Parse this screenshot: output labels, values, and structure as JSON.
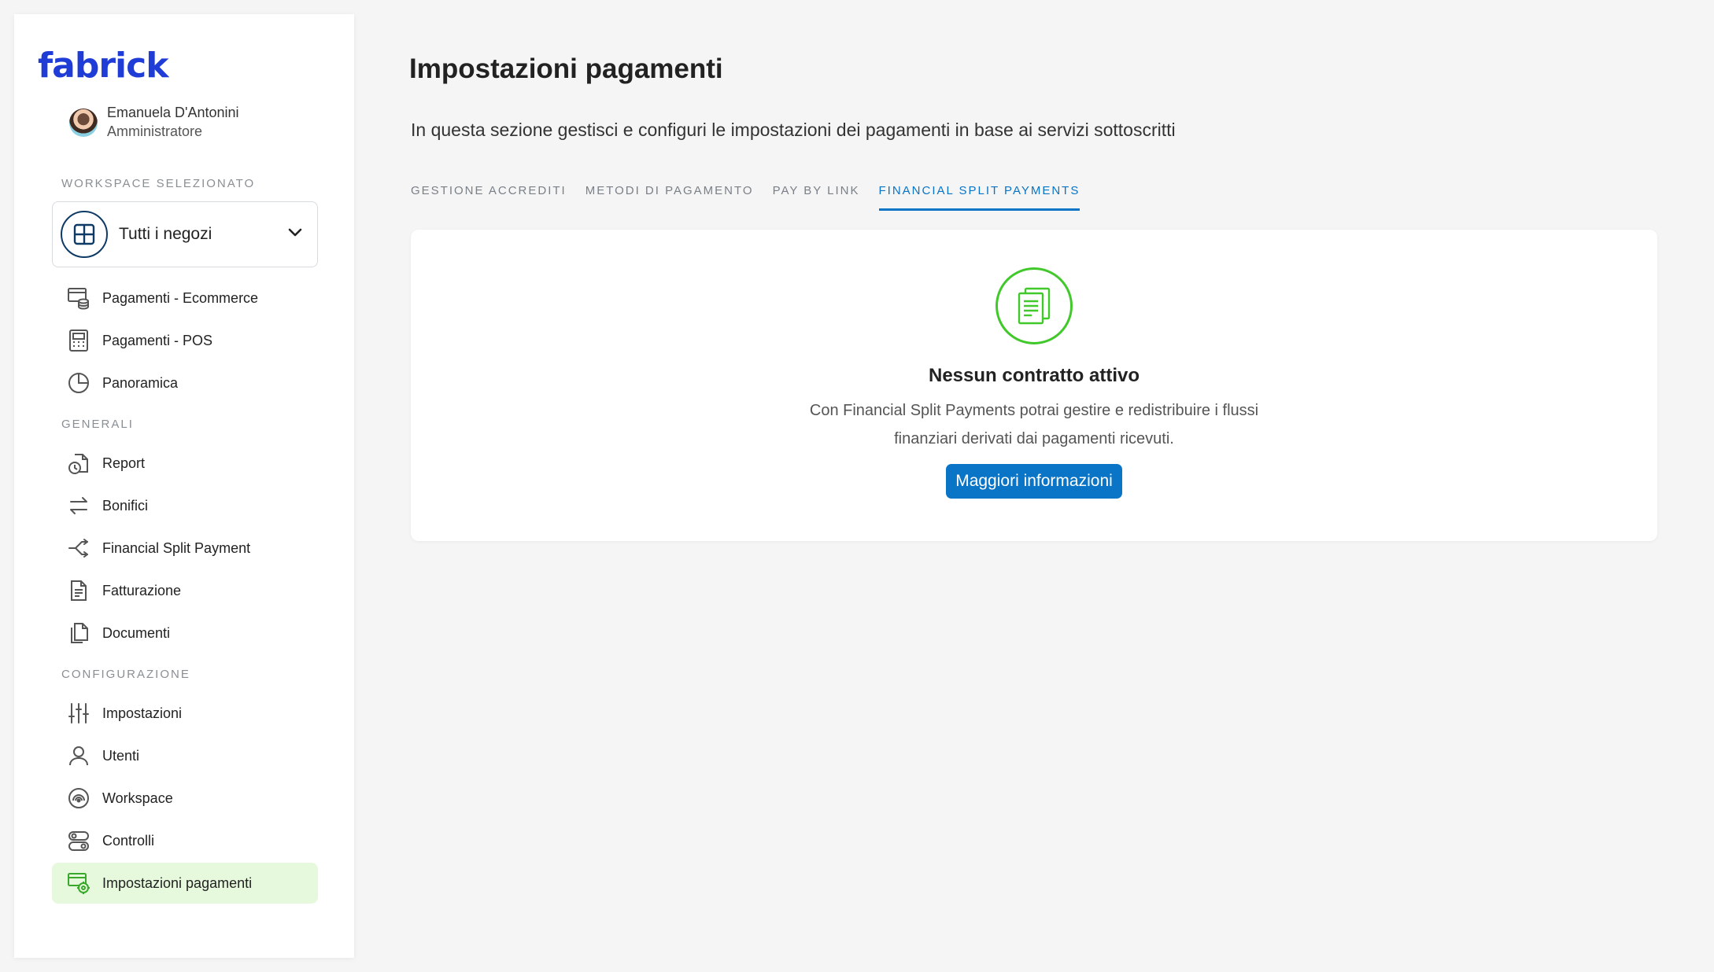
{
  "brand": {
    "logo_text": "fabrick",
    "logo_color": "#1f3dd6"
  },
  "user": {
    "name": "Emanuela D'Antonini",
    "role": "Amministratore"
  },
  "sidebar": {
    "workspace_section_label": "WORKSPACE SELEZIONATO",
    "workspace_select": {
      "value": "Tutti i negozi"
    },
    "top_items": [
      {
        "label": "Pagamenti - Ecommerce",
        "icon": "ecommerce-payments-icon"
      },
      {
        "label": "Pagamenti - POS",
        "icon": "pos-icon"
      },
      {
        "label": "Panoramica",
        "icon": "pie-chart-icon"
      }
    ],
    "generali_label": "GENERALI",
    "generali_items": [
      {
        "label": "Report",
        "icon": "report-icon"
      },
      {
        "label": "Bonifici",
        "icon": "transfer-arrows-icon"
      },
      {
        "label": "Financial Split Payment",
        "icon": "split-icon"
      },
      {
        "label": "Fatturazione",
        "icon": "invoice-icon"
      },
      {
        "label": "Documenti",
        "icon": "documents-icon"
      }
    ],
    "config_label": "CONFIGURAZIONE",
    "config_items": [
      {
        "label": "Impostazioni",
        "icon": "sliders-icon"
      },
      {
        "label": "Utenti",
        "icon": "user-icon"
      },
      {
        "label": "Workspace",
        "icon": "workspace-icon"
      },
      {
        "label": "Controlli",
        "icon": "toggles-icon"
      },
      {
        "label": "Impostazioni pagamenti",
        "icon": "payment-settings-icon",
        "active": true
      }
    ]
  },
  "main": {
    "title": "Impostazioni pagamenti",
    "description": "In questa sezione gestisci e configuri le impostazioni dei pagamenti in base ai servizi sottoscritti",
    "tabs": [
      {
        "label": "GESTIONE ACCREDITI"
      },
      {
        "label": "METODI DI PAGAMENTO"
      },
      {
        "label": "PAY BY LINK"
      },
      {
        "label": "FINANCIAL SPLIT PAYMENTS",
        "active": true
      }
    ],
    "empty_state": {
      "title": "Nessun contratto attivo",
      "description": "Con Financial Split Payments potrai gestire e redistribuire i flussi finanziari derivati dai pagamenti ricevuti.",
      "button_label": "Maggiori informazioni"
    }
  },
  "colors": {
    "accent": "#0a74c6",
    "success_green": "#41c82a",
    "active_nav_bg": "#e6f9dc"
  }
}
